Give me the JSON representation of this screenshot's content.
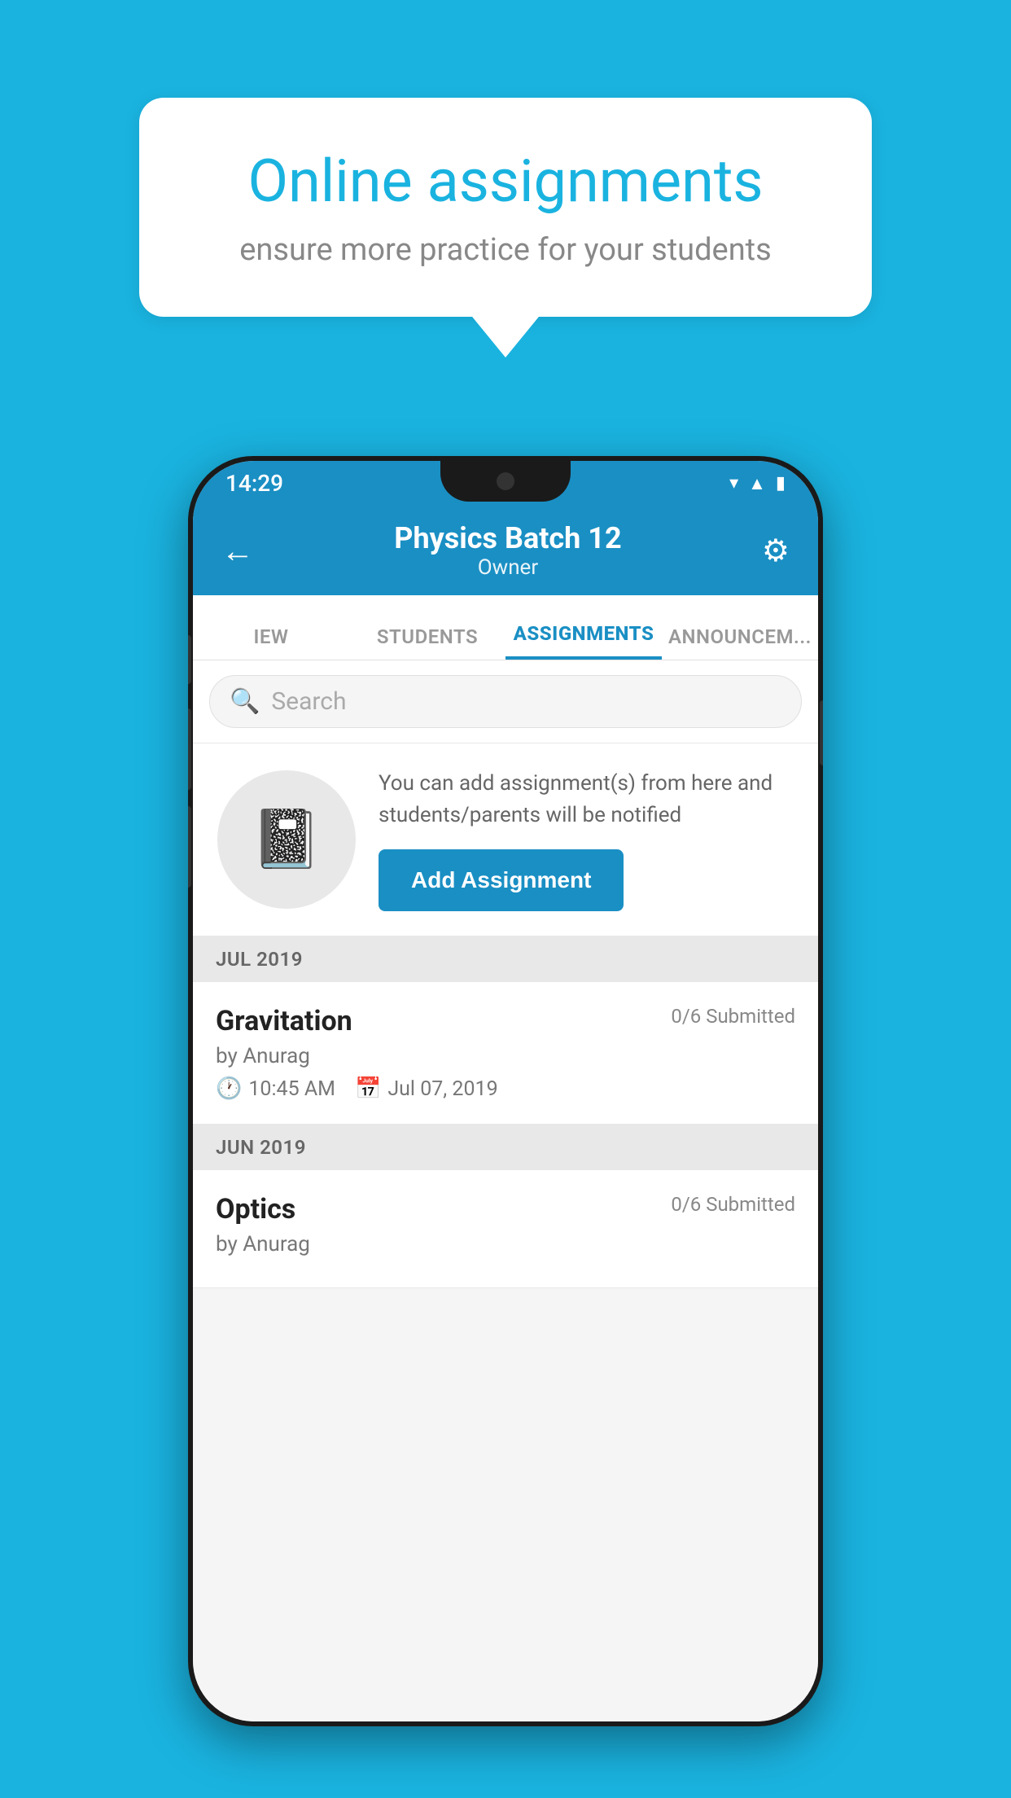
{
  "background_color": "#1ab3e0",
  "promo": {
    "title": "Online assignments",
    "subtitle": "ensure more practice for your students"
  },
  "phone": {
    "status_bar": {
      "time": "14:29"
    },
    "header": {
      "title": "Physics Batch 12",
      "subtitle": "Owner",
      "back_label": "←",
      "settings_label": "⚙"
    },
    "tabs": [
      {
        "label": "IEW",
        "active": false
      },
      {
        "label": "STUDENTS",
        "active": false
      },
      {
        "label": "ASSIGNMENTS",
        "active": true
      },
      {
        "label": "ANNOUNCEM...",
        "active": false
      }
    ],
    "search": {
      "placeholder": "Search"
    },
    "assignment_promo": {
      "description": "You can add assignment(s) from here and students/parents will be notified",
      "button_label": "Add Assignment"
    },
    "sections": [
      {
        "month_label": "JUL 2019",
        "items": [
          {
            "name": "Gravitation",
            "submitted": "0/6 Submitted",
            "by": "by Anurag",
            "time": "10:45 AM",
            "date": "Jul 07, 2019"
          }
        ]
      },
      {
        "month_label": "JUN 2019",
        "items": [
          {
            "name": "Optics",
            "submitted": "0/6 Submitted",
            "by": "by Anurag",
            "time": "",
            "date": ""
          }
        ]
      }
    ]
  }
}
